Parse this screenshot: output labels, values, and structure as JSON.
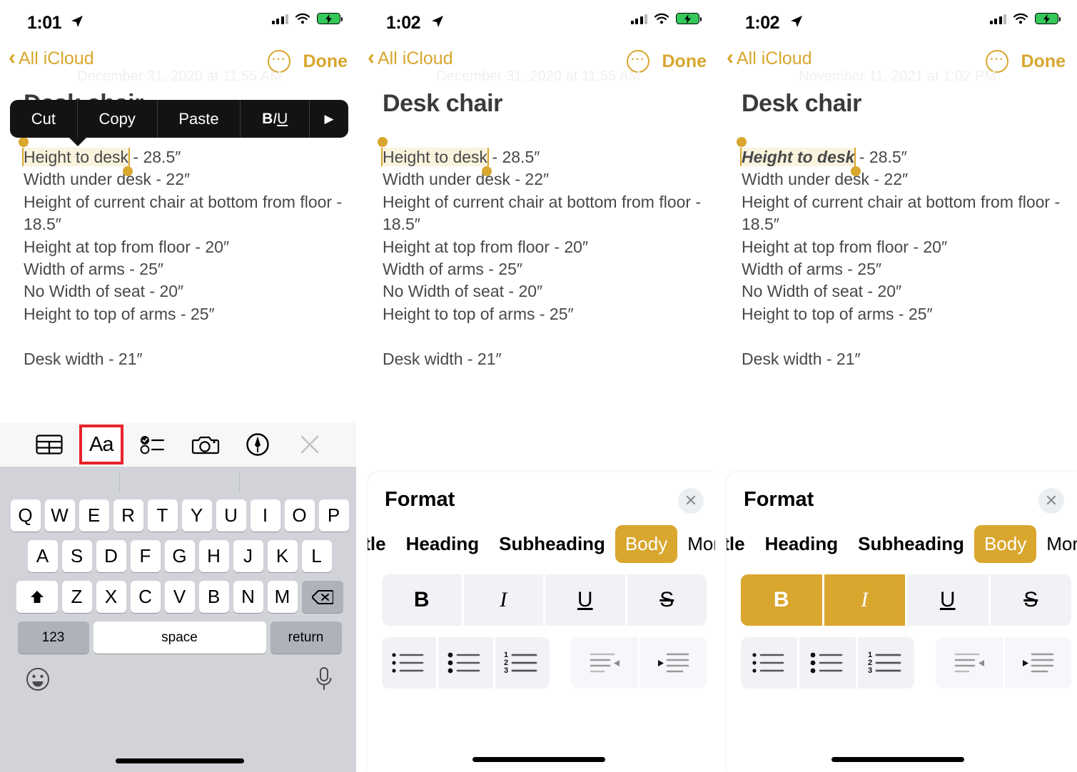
{
  "accent_color": "#d9a62e",
  "highlight_color": "#faf3dd",
  "red_box_color": "#e8232a",
  "panels": [
    {
      "id": "panel-1",
      "status_bar": {
        "time": "1:01",
        "location_icon": "location-arrow-icon",
        "signal_icon": "cellular-signal-icon",
        "wifi_icon": "wifi-icon",
        "battery_icon": "battery-charging-icon"
      },
      "nav": {
        "back_label": "All iCloud",
        "more_icon": "ellipsis-circle-icon",
        "done_label": "Done"
      },
      "note": {
        "date": "December 31, 2020 at 11:55 AM",
        "title": "Desk chair",
        "selected_text": "Height to desk",
        "selected_format": "plain",
        "lines": [
          " - 28.5″",
          "Width under desk - 22″",
          "Height of current chair at bottom from floor - 18.5″",
          "Height at top from floor - 20″",
          "Width of arms - 25″",
          "No Width of seat - 20″",
          "Height to top of arms - 25″",
          "",
          "Desk width - 21″"
        ]
      },
      "edit_menu": {
        "items": [
          "Cut",
          "Copy",
          "Paste"
        ],
        "style_label": "BIU",
        "more_arrow": "▶"
      },
      "keyboard_accessory": {
        "tools": [
          {
            "name": "table-icon",
            "label": ""
          },
          {
            "name": "text-format-aa-icon",
            "label": "Aa",
            "highlighted": true
          },
          {
            "name": "checklist-icon",
            "label": ""
          },
          {
            "name": "camera-icon",
            "label": ""
          },
          {
            "name": "markup-pen-icon",
            "label": ""
          },
          {
            "name": "close-icon",
            "label": ""
          }
        ]
      },
      "keyboard": {
        "row1": [
          "Q",
          "W",
          "E",
          "R",
          "T",
          "Y",
          "U",
          "I",
          "O",
          "P"
        ],
        "row2": [
          "A",
          "S",
          "D",
          "F",
          "G",
          "H",
          "J",
          "K",
          "L"
        ],
        "row3": [
          "Z",
          "X",
          "C",
          "V",
          "B",
          "N",
          "M"
        ],
        "shift_icon": "shift-icon",
        "delete_icon": "backspace-icon",
        "numbers_label": "123",
        "space_label": "space",
        "return_label": "return",
        "emoji_icon": "emoji-smiley-icon",
        "dictation_icon": "microphone-icon"
      }
    },
    {
      "id": "panel-2",
      "status_bar": {
        "time": "1:02",
        "location_icon": "location-arrow-icon",
        "signal_icon": "cellular-signal-icon",
        "wifi_icon": "wifi-icon",
        "battery_icon": "battery-charging-icon"
      },
      "nav": {
        "back_label": "All iCloud",
        "more_icon": "ellipsis-circle-icon",
        "done_label": "Done"
      },
      "note": {
        "date": "December 31, 2020 at 11:55 AM",
        "title": "Desk chair",
        "selected_text": "Height to desk",
        "selected_format": "plain",
        "lines": [
          " - 28.5″",
          "Width under desk - 22″",
          "Height of current chair at bottom from floor - 18.5″",
          "Height at top from floor - 20″",
          "Width of arms - 25″",
          "No Width of seat - 20″",
          "Height to top of arms - 25″",
          "",
          "Desk width - 21″"
        ]
      },
      "format_sheet": {
        "title": "Format",
        "close_icon": "close-circle-icon",
        "styles": [
          {
            "label": "itle",
            "active": false,
            "clipped": true
          },
          {
            "label": "Heading",
            "active": false
          },
          {
            "label": "Subheading",
            "active": false
          },
          {
            "label": "Body",
            "active": true
          },
          {
            "label": "Mor",
            "active": false,
            "plain": true
          }
        ],
        "text_styles": [
          {
            "name": "bold-button",
            "glyph": "B",
            "on": false
          },
          {
            "name": "italic-button",
            "glyph": "I",
            "on": false
          },
          {
            "name": "underline-button",
            "glyph": "U",
            "on": false
          },
          {
            "name": "strikethrough-button",
            "glyph": "S",
            "on": false
          }
        ],
        "list_styles": [
          {
            "name": "dashed-list-button"
          },
          {
            "name": "bulleted-list-button"
          },
          {
            "name": "numbered-list-button"
          },
          {
            "name": "outdent-button"
          },
          {
            "name": "indent-button"
          }
        ]
      }
    },
    {
      "id": "panel-3",
      "status_bar": {
        "time": "1:02",
        "location_icon": "location-arrow-icon",
        "signal_icon": "cellular-signal-icon",
        "wifi_icon": "wifi-icon",
        "battery_icon": "battery-charging-icon"
      },
      "nav": {
        "back_label": "All iCloud",
        "more_icon": "ellipsis-circle-icon",
        "done_label": "Done"
      },
      "note": {
        "date": "November 11, 2021 at 1:02 PM",
        "title": "Desk chair",
        "selected_text": "Height to desk",
        "selected_format": "bold-italic",
        "lines": [
          " - 28.5″",
          "Width under desk - 22″",
          "Height of current chair at bottom from floor - 18.5″",
          "Height at top from floor - 20″",
          "Width of arms - 25″",
          "No Width of seat - 20″",
          "Height to top of arms - 25″",
          "",
          "Desk width - 21″"
        ]
      },
      "format_sheet": {
        "title": "Format",
        "close_icon": "close-circle-icon",
        "styles": [
          {
            "label": "itle",
            "active": false,
            "clipped": true
          },
          {
            "label": "Heading",
            "active": false
          },
          {
            "label": "Subheading",
            "active": false
          },
          {
            "label": "Body",
            "active": true
          },
          {
            "label": "Mor",
            "active": false,
            "plain": true
          }
        ],
        "text_styles": [
          {
            "name": "bold-button",
            "glyph": "B",
            "on": true
          },
          {
            "name": "italic-button",
            "glyph": "I",
            "on": true
          },
          {
            "name": "underline-button",
            "glyph": "U",
            "on": false
          },
          {
            "name": "strikethrough-button",
            "glyph": "S",
            "on": false
          }
        ],
        "list_styles": [
          {
            "name": "dashed-list-button"
          },
          {
            "name": "bulleted-list-button"
          },
          {
            "name": "numbered-list-button"
          },
          {
            "name": "outdent-button"
          },
          {
            "name": "indent-button"
          }
        ]
      }
    }
  ]
}
